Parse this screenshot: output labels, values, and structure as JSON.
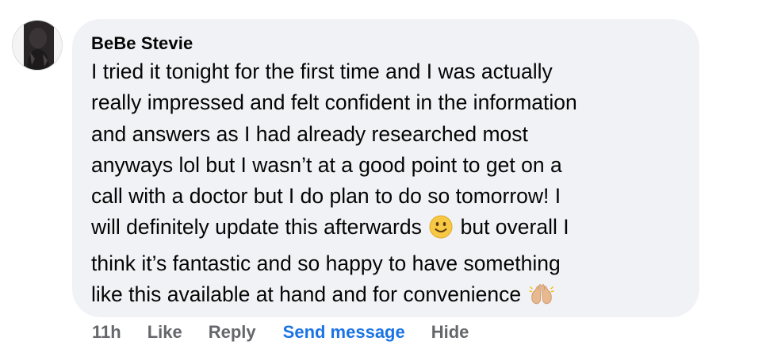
{
  "comment": {
    "author": "BeBe Stevie",
    "lines": [
      "I tried it tonight for the first time and I was actually",
      "really impressed and felt confident in the information",
      "and answers as I had already researched most",
      "anyways lol but I wasn’t at a good point to get on a",
      "call with a doctor but I do plan to do so tomorrow! I",
      "will definitely update this afterwards",
      "but overall I",
      "think it’s fantastic and so happy to have something",
      "like this available at hand and for convenience"
    ],
    "emojis": {
      "smile": "slightly-smiling-face-icon",
      "hands": "raising-hands-icon"
    }
  },
  "actions": {
    "time": "11h",
    "like": "Like",
    "reply": "Reply",
    "send_message": "Send message",
    "hide": "Hide"
  },
  "colors": {
    "bubble": "#f0f2f5",
    "text": "#050505",
    "secondary": "#65676b",
    "link": "#1b74e4"
  }
}
